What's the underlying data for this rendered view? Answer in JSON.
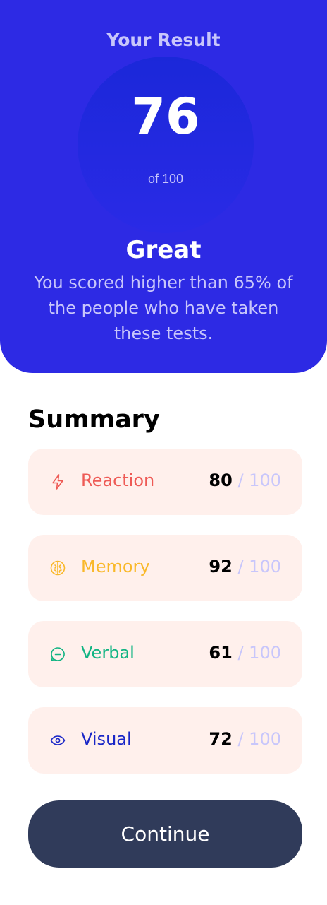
{
  "result": {
    "heading": "Your Result",
    "score": "76",
    "out_of": "of 100",
    "rating": "Great",
    "description": "You scored higher than 65% of the people who have taken these tests."
  },
  "summary": {
    "title": "Summary",
    "items": [
      {
        "label": "Reaction",
        "score": "80",
        "max": "/ 100",
        "icon": "lightning-icon",
        "color": "#ee5a55"
      },
      {
        "label": "Memory",
        "score": "92",
        "max": "/ 100",
        "icon": "brain-icon",
        "color": "#f9b829"
      },
      {
        "label": "Verbal",
        "score": "61",
        "max": "/ 100",
        "icon": "chat-bubble-icon",
        "color": "#11b483"
      },
      {
        "label": "Visual",
        "score": "72",
        "max": "/ 100",
        "icon": "eye-icon",
        "color": "#1a27c7"
      }
    ]
  },
  "actions": {
    "continue_label": "Continue"
  },
  "colors": {
    "primary": "#2d2ae4",
    "button": "#303b5a",
    "row_background": "#fff0ec",
    "muted_lavender": "#c8c6fb"
  }
}
